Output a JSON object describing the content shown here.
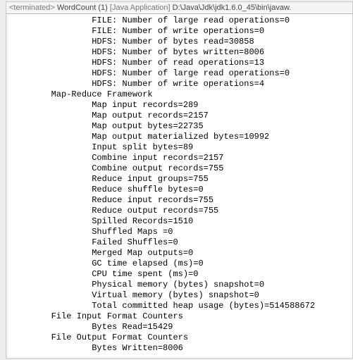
{
  "header": {
    "status": "<terminated>",
    "app_name": "WordCount (1)",
    "app_type": "[Java Application]",
    "path": "D:\\Java\\Jdk\\jdk1.6.0_45\\bin\\javaw."
  },
  "console": {
    "lines": [
      {
        "indent": 3,
        "text": "FILE: Number of large read operations=0"
      },
      {
        "indent": 3,
        "text": "FILE: Number of write operations=0"
      },
      {
        "indent": 3,
        "text": "HDFS: Number of bytes read=30858"
      },
      {
        "indent": 3,
        "text": "HDFS: Number of bytes written=8006"
      },
      {
        "indent": 3,
        "text": "HDFS: Number of read operations=13"
      },
      {
        "indent": 3,
        "text": "HDFS: Number of large read operations=0"
      },
      {
        "indent": 3,
        "text": "HDFS: Number of write operations=4"
      },
      {
        "indent": 1,
        "text": "Map-Reduce Framework"
      },
      {
        "indent": 3,
        "text": "Map input records=289"
      },
      {
        "indent": 3,
        "text": "Map output records=2157"
      },
      {
        "indent": 3,
        "text": "Map output bytes=22735"
      },
      {
        "indent": 3,
        "text": "Map output materialized bytes=10992"
      },
      {
        "indent": 3,
        "text": "Input split bytes=89"
      },
      {
        "indent": 3,
        "text": "Combine input records=2157"
      },
      {
        "indent": 3,
        "text": "Combine output records=755"
      },
      {
        "indent": 3,
        "text": "Reduce input groups=755"
      },
      {
        "indent": 3,
        "text": "Reduce shuffle bytes=0"
      },
      {
        "indent": 3,
        "text": "Reduce input records=755"
      },
      {
        "indent": 3,
        "text": "Reduce output records=755"
      },
      {
        "indent": 3,
        "text": "Spilled Records=1510"
      },
      {
        "indent": 3,
        "text": "Shuffled Maps =0"
      },
      {
        "indent": 3,
        "text": "Failed Shuffles=0"
      },
      {
        "indent": 3,
        "text": "Merged Map outputs=0"
      },
      {
        "indent": 3,
        "text": "GC time elapsed (ms)=0"
      },
      {
        "indent": 3,
        "text": "CPU time spent (ms)=0"
      },
      {
        "indent": 3,
        "text": "Physical memory (bytes) snapshot=0"
      },
      {
        "indent": 3,
        "text": "Virtual memory (bytes) snapshot=0"
      },
      {
        "indent": 3,
        "text": "Total committed heap usage (bytes)=514588672"
      },
      {
        "indent": 1,
        "text": "File Input Format Counters "
      },
      {
        "indent": 3,
        "text": "Bytes Read=15429"
      },
      {
        "indent": 1,
        "text": "File Output Format Counters "
      },
      {
        "indent": 3,
        "text": "Bytes Written=8006"
      }
    ]
  }
}
